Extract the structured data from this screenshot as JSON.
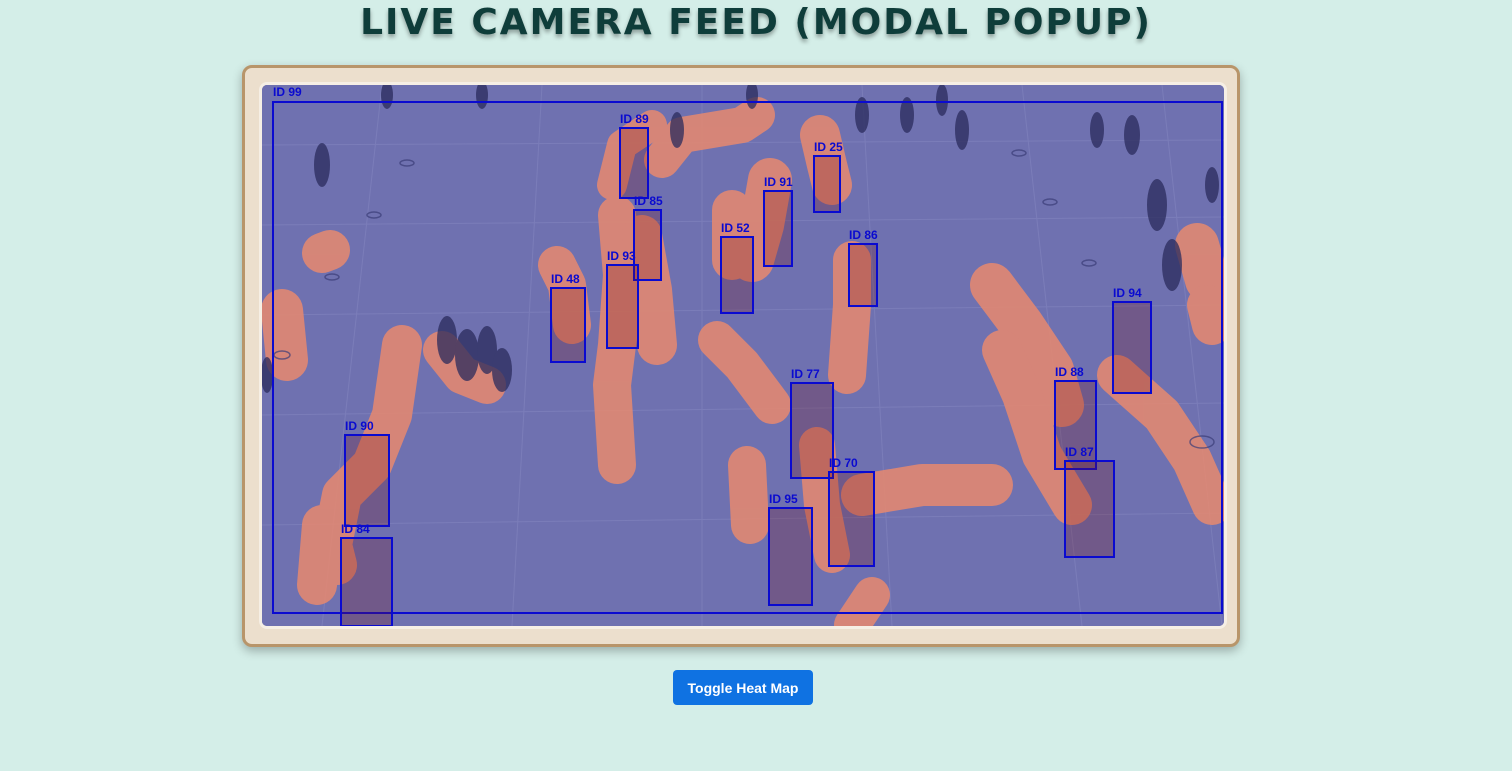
{
  "page": {
    "title": "LIVE CAMERA FEED (MODAL POPUP)"
  },
  "controls": {
    "toggle_heatmap_label": "Toggle Heat Map"
  },
  "colors": {
    "background": "#d4eee8",
    "title": "#0f3d3a",
    "frame": "#ecdfcd",
    "frame_border": "#b8956a",
    "button": "#0f72e2",
    "overlay": "#6f71b0",
    "heat": "#e8896f",
    "box": "#0a0ad0"
  },
  "feed": {
    "zone_label": "ID 99",
    "detections": [
      {
        "label": "ID 89"
      },
      {
        "label": "ID 25"
      },
      {
        "label": "ID 85"
      },
      {
        "label": "ID 91"
      },
      {
        "label": "ID 52"
      },
      {
        "label": "ID 86"
      },
      {
        "label": "ID 93"
      },
      {
        "label": "ID 48"
      },
      {
        "label": "ID 94"
      },
      {
        "label": "ID 77"
      },
      {
        "label": "ID 88"
      },
      {
        "label": "ID 90"
      },
      {
        "label": "ID 70"
      },
      {
        "label": "ID 87"
      },
      {
        "label": "ID 95"
      },
      {
        "label": "ID 84"
      }
    ]
  }
}
